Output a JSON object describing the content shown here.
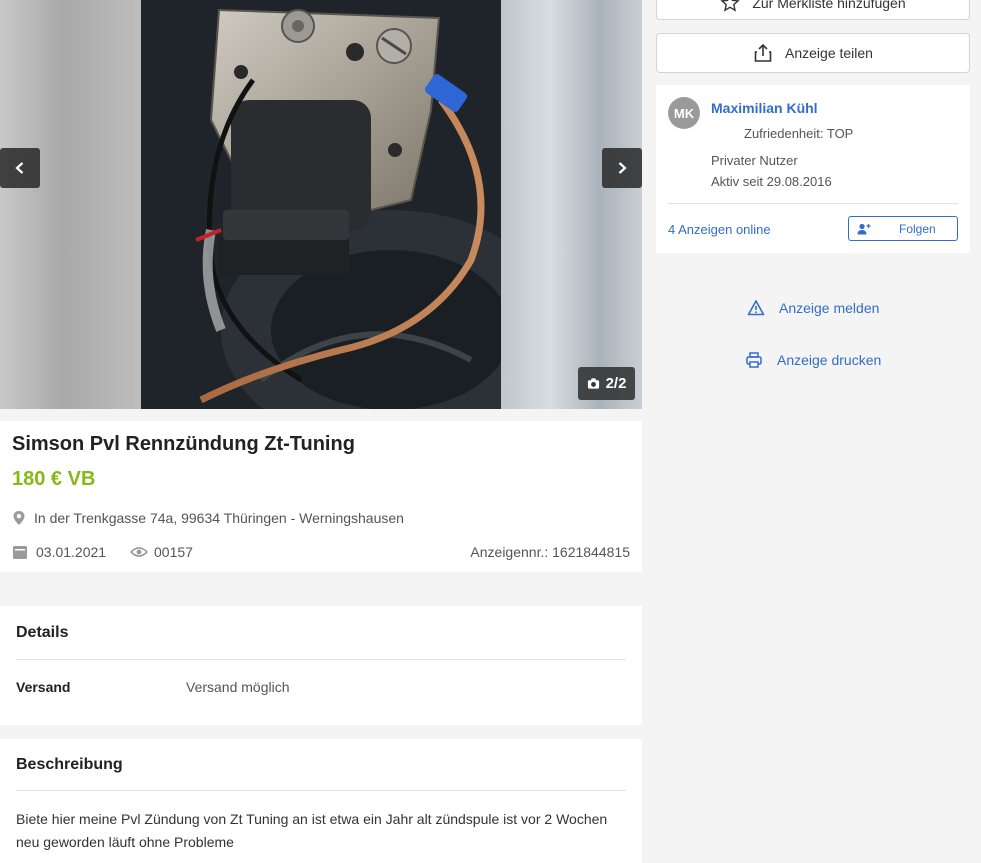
{
  "gallery": {
    "counter": "2/2"
  },
  "listing": {
    "title": "Simson Pvl Rennzündung Zt-Tuning",
    "price": "180 € VB",
    "location": "In der Trenkgasse 74a, 99634 Thüringen - Werningshausen",
    "date": "03.01.2021",
    "views": "00157",
    "ad_number": "Anzeigennr.: 1621844815"
  },
  "details": {
    "heading": "Details",
    "rows": [
      {
        "label": "Versand",
        "value": "Versand möglich"
      }
    ]
  },
  "description": {
    "heading": "Beschreibung",
    "text": "Biete hier meine Pvl Zündung von Zt Tuning an ist etwa ein Jahr alt zündspule ist vor 2 Wochen neu geworden läuft ohne Probleme"
  },
  "sidebar": {
    "watchlist_label": "Zur Merkliste hinzufügen",
    "share_label": "Anzeige teilen",
    "seller": {
      "initials": "MK",
      "name": "Maximilian Kühl",
      "satisfaction": "Zufriedenheit: TOP",
      "type": "Privater Nutzer",
      "active_since": "Aktiv seit 29.08.2016",
      "ads_online": "4 Anzeigen online",
      "follow_label": "Folgen"
    },
    "report_label": "Anzeige melden",
    "print_label": "Anzeige drucken"
  },
  "colors": {
    "price_green": "#86b817",
    "link_blue": "#326ccc"
  }
}
